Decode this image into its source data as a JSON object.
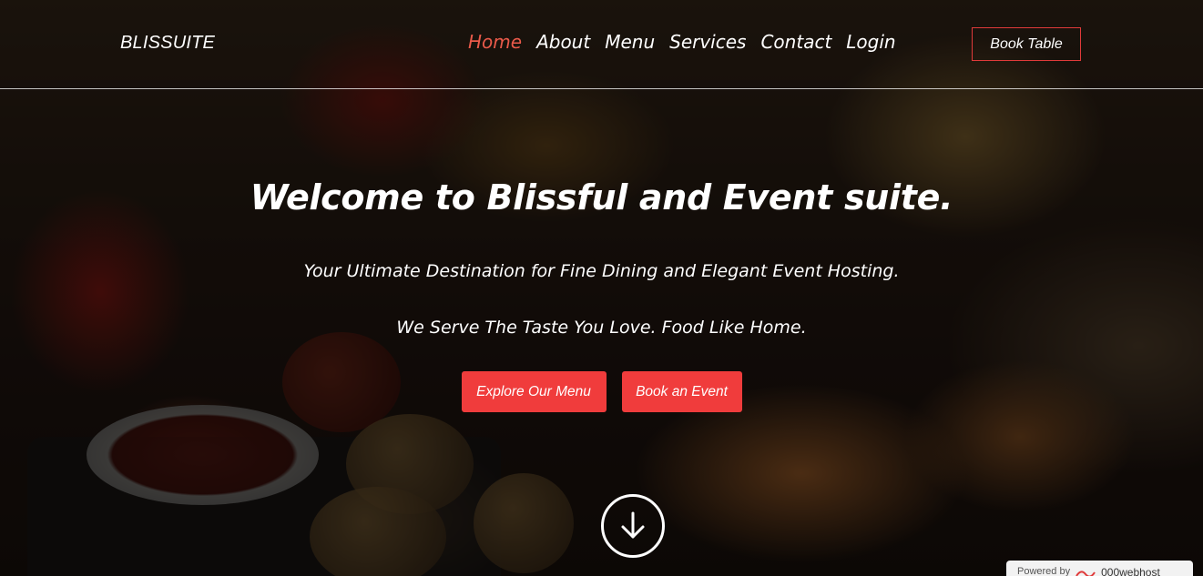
{
  "brand": {
    "name": "BLISSUITE"
  },
  "nav": {
    "items": [
      {
        "label": "Home",
        "active": true
      },
      {
        "label": "About",
        "active": false
      },
      {
        "label": "Menu",
        "active": false
      },
      {
        "label": "Services",
        "active": false
      },
      {
        "label": "Contact",
        "active": false
      },
      {
        "label": "Login",
        "active": false
      }
    ],
    "book_table_label": "Book Table"
  },
  "hero": {
    "title": "Welcome to Blissful and Event suite.",
    "subtitle": "Your Ultimate Destination for Fine Dining and Elegant Event Hosting.",
    "tagline": "We Serve The Taste You Love. Food Like Home.",
    "buttons": {
      "explore_menu": "Explore Our Menu",
      "book_event": "Book an Event"
    },
    "scroll_icon": "arrow-down-circle-icon"
  },
  "footer_badge": {
    "powered_by": "Powered by",
    "host": "000webhost"
  },
  "colors": {
    "accent": "#f03c3c",
    "active_nav": "#ea5a4a",
    "text": "#ffffff"
  }
}
